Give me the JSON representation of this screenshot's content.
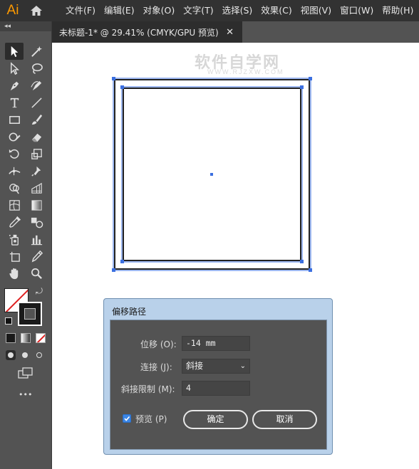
{
  "app": {
    "logo": "Ai",
    "home_icon": "home-icon"
  },
  "menubar": {
    "items": [
      "文件(F)",
      "编辑(E)",
      "对象(O)",
      "文字(T)",
      "选择(S)",
      "效果(C)",
      "视图(V)",
      "窗口(W)",
      "帮助(H)"
    ]
  },
  "toolbox": {
    "collapse_glyph": "◂◂",
    "tools": [
      [
        "selection-tool-icon",
        "magic-wand-icon"
      ],
      [
        "direct-selection-icon",
        "lasso-icon"
      ],
      [
        "pen-tool-icon",
        "curvature-tool-icon"
      ],
      [
        "type-tool-icon",
        "line-tool-icon"
      ],
      [
        "rectangle-tool-icon",
        "paintbrush-icon"
      ],
      [
        "shaper-tool-icon",
        "eraser-icon"
      ],
      [
        "rotate-tool-icon",
        "scale-tool-icon"
      ],
      [
        "width-tool-icon",
        "puppet-warp-icon"
      ],
      [
        "shape-builder-icon",
        "perspective-grid-icon"
      ],
      [
        "mesh-tool-icon",
        "gradient-tool-icon"
      ],
      [
        "eyedropper-icon",
        "blend-tool-icon"
      ],
      [
        "symbol-sprayer-icon",
        "column-graph-icon"
      ],
      [
        "artboard-tool-icon",
        "slice-tool-icon"
      ],
      [
        "hand-tool-icon",
        "zoom-tool-icon"
      ]
    ],
    "more_glyph": "•••"
  },
  "document": {
    "tab_label": "未标题-1* @ 29.41% (CMYK/GPU 预览)",
    "close_glyph": "✕"
  },
  "canvas": {
    "watermark": "软件自学网",
    "watermark_sub": "WWW.RJZXW.COM",
    "selection_color": "#3b6fe0"
  },
  "dialog": {
    "title": "偏移路径",
    "offset_label": "位移 (O):",
    "offset_value": "-14 mm",
    "join_label": "连接 (J):",
    "join_value": "斜接",
    "miter_label": "斜接限制 (M):",
    "miter_value": "4",
    "preview_label": "预览 (P)",
    "preview_checked": true,
    "ok_label": "确定",
    "cancel_label": "取消"
  }
}
